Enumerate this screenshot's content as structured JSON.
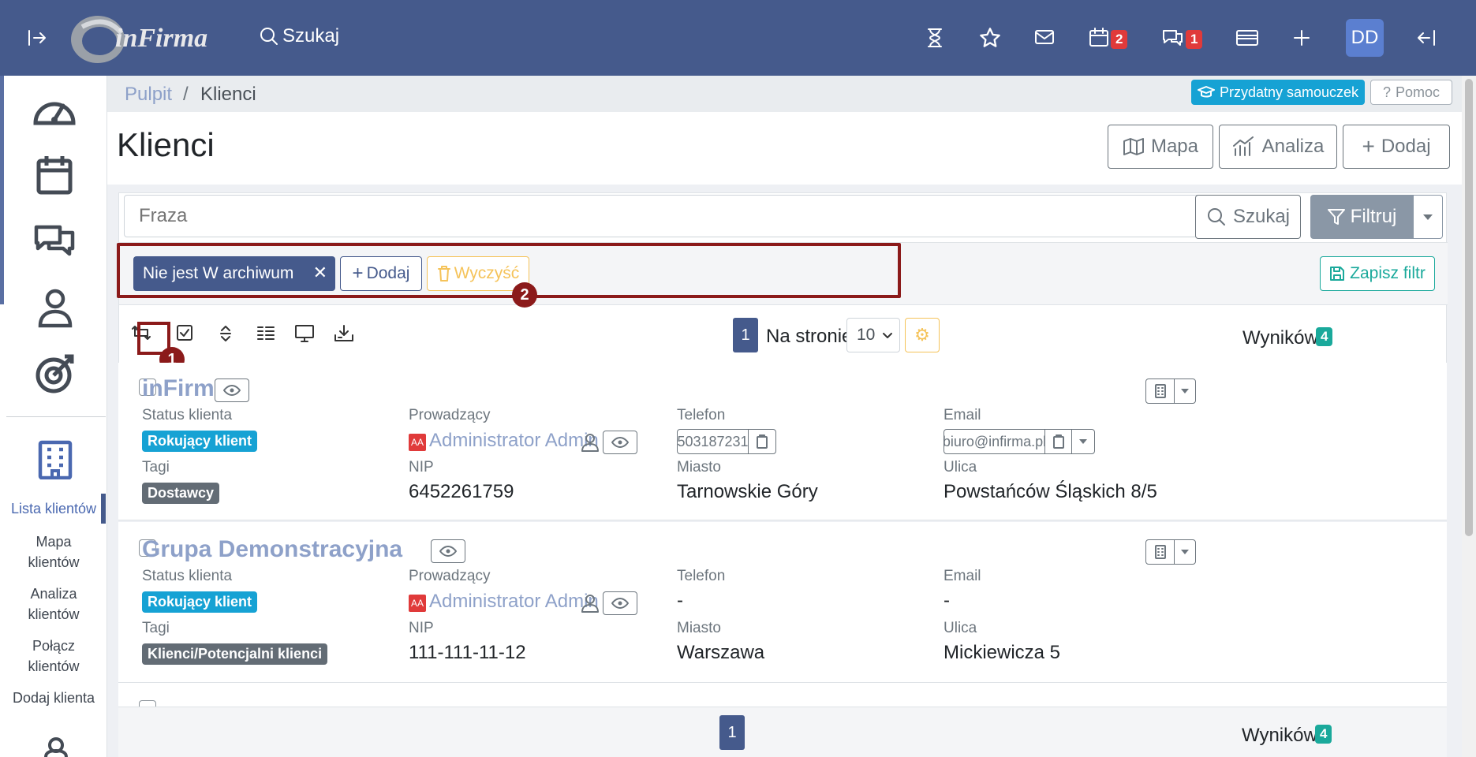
{
  "topbar": {
    "logo_text": "inFirma",
    "search_label": "Szukaj",
    "calendar_badge": "2",
    "chat_badge": "1",
    "user_initials": "DD"
  },
  "sidebar": {
    "items": [
      "Lista klientów",
      "Mapa klientów",
      "Analiza klientów",
      "Połącz klientów",
      "Dodaj klienta"
    ]
  },
  "breadcrumb": {
    "home": "Pulpit",
    "sep": "/",
    "current": "Klienci"
  },
  "help": {
    "tutorial": "Przydatny samouczek",
    "help": "Pomoc"
  },
  "page": {
    "title": "Klienci",
    "map": "Mapa",
    "analysis": "Analiza",
    "add": "Dodaj"
  },
  "search": {
    "placeholder": "Fraza",
    "button": "Szukaj",
    "filter": "Filtruj"
  },
  "filters": {
    "chip": "Nie jest W archiwum",
    "add": "Dodaj",
    "clear": "Wyczyść",
    "save": "Zapisz filtr"
  },
  "annotations": {
    "one": "1",
    "two": "2"
  },
  "toolbar": {
    "page": "1",
    "per_page_label": "Na stronie:",
    "per_page": "10",
    "results_label": "Wyników:",
    "results": "4"
  },
  "clients": [
    {
      "name": "inFirma",
      "status_label": "Status klienta",
      "status": "Rokujący klient",
      "tags_label": "Tagi",
      "tag": "Dostawcy",
      "owner_label": "Prowadzący",
      "owner_avatar": "AA",
      "owner": "Administrator Admin",
      "nip_label": "NIP",
      "nip": "6452261759",
      "phone_label": "Telefon",
      "phone": "503187231",
      "city_label": "Miasto",
      "city": "Tarnowskie Góry",
      "email_label": "Email",
      "email": "biuro@infirma.pl",
      "street_label": "Ulica",
      "street": "Powstańców Śląskich 8/5"
    },
    {
      "name": "Grupa Demonstracyjna",
      "status_label": "Status klienta",
      "status": "Rokujący klient",
      "tags_label": "Tagi",
      "tag": "Klienci/Potencjalni klienci",
      "owner_label": "Prowadzący",
      "owner_avatar": "AA",
      "owner": "Administrator Admin",
      "nip_label": "NIP",
      "nip": "111-111-11-12",
      "phone_label": "Telefon",
      "phone": "-",
      "city_label": "Miasto",
      "city": "Warszawa",
      "email_label": "Email",
      "email": "-",
      "street_label": "Ulica",
      "street": "Mickiewicza 5"
    }
  ],
  "colors": {
    "topbar": "#455a8c",
    "accent": "#16a2d4",
    "annotation": "#8b1a1a",
    "link": "#8ea1c9"
  }
}
